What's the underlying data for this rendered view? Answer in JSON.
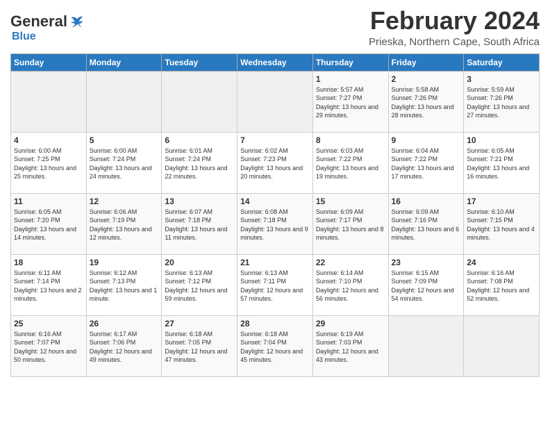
{
  "header": {
    "logo_general": "General",
    "logo_blue": "Blue",
    "title": "February 2024",
    "location": "Prieska, Northern Cape, South Africa"
  },
  "weekdays": [
    "Sunday",
    "Monday",
    "Tuesday",
    "Wednesday",
    "Thursday",
    "Friday",
    "Saturday"
  ],
  "weeks": [
    [
      {
        "day": "",
        "empty": true
      },
      {
        "day": "",
        "empty": true
      },
      {
        "day": "",
        "empty": true
      },
      {
        "day": "",
        "empty": true
      },
      {
        "day": "1",
        "sunrise": "Sunrise: 5:57 AM",
        "sunset": "Sunset: 7:27 PM",
        "daylight": "Daylight: 13 hours and 29 minutes."
      },
      {
        "day": "2",
        "sunrise": "Sunrise: 5:58 AM",
        "sunset": "Sunset: 7:26 PM",
        "daylight": "Daylight: 13 hours and 28 minutes."
      },
      {
        "day": "3",
        "sunrise": "Sunrise: 5:59 AM",
        "sunset": "Sunset: 7:26 PM",
        "daylight": "Daylight: 13 hours and 27 minutes."
      }
    ],
    [
      {
        "day": "4",
        "sunrise": "Sunrise: 6:00 AM",
        "sunset": "Sunset: 7:25 PM",
        "daylight": "Daylight: 13 hours and 25 minutes."
      },
      {
        "day": "5",
        "sunrise": "Sunrise: 6:00 AM",
        "sunset": "Sunset: 7:24 PM",
        "daylight": "Daylight: 13 hours and 24 minutes."
      },
      {
        "day": "6",
        "sunrise": "Sunrise: 6:01 AM",
        "sunset": "Sunset: 7:24 PM",
        "daylight": "Daylight: 13 hours and 22 minutes."
      },
      {
        "day": "7",
        "sunrise": "Sunrise: 6:02 AM",
        "sunset": "Sunset: 7:23 PM",
        "daylight": "Daylight: 13 hours and 20 minutes."
      },
      {
        "day": "8",
        "sunrise": "Sunrise: 6:03 AM",
        "sunset": "Sunset: 7:22 PM",
        "daylight": "Daylight: 13 hours and 19 minutes."
      },
      {
        "day": "9",
        "sunrise": "Sunrise: 6:04 AM",
        "sunset": "Sunset: 7:22 PM",
        "daylight": "Daylight: 13 hours and 17 minutes."
      },
      {
        "day": "10",
        "sunrise": "Sunrise: 6:05 AM",
        "sunset": "Sunset: 7:21 PM",
        "daylight": "Daylight: 13 hours and 16 minutes."
      }
    ],
    [
      {
        "day": "11",
        "sunrise": "Sunrise: 6:05 AM",
        "sunset": "Sunset: 7:20 PM",
        "daylight": "Daylight: 13 hours and 14 minutes."
      },
      {
        "day": "12",
        "sunrise": "Sunrise: 6:06 AM",
        "sunset": "Sunset: 7:19 PM",
        "daylight": "Daylight: 13 hours and 12 minutes."
      },
      {
        "day": "13",
        "sunrise": "Sunrise: 6:07 AM",
        "sunset": "Sunset: 7:18 PM",
        "daylight": "Daylight: 13 hours and 11 minutes."
      },
      {
        "day": "14",
        "sunrise": "Sunrise: 6:08 AM",
        "sunset": "Sunset: 7:18 PM",
        "daylight": "Daylight: 13 hours and 9 minutes."
      },
      {
        "day": "15",
        "sunrise": "Sunrise: 6:09 AM",
        "sunset": "Sunset: 7:17 PM",
        "daylight": "Daylight: 13 hours and 8 minutes."
      },
      {
        "day": "16",
        "sunrise": "Sunrise: 6:09 AM",
        "sunset": "Sunset: 7:16 PM",
        "daylight": "Daylight: 13 hours and 6 minutes."
      },
      {
        "day": "17",
        "sunrise": "Sunrise: 6:10 AM",
        "sunset": "Sunset: 7:15 PM",
        "daylight": "Daylight: 13 hours and 4 minutes."
      }
    ],
    [
      {
        "day": "18",
        "sunrise": "Sunrise: 6:11 AM",
        "sunset": "Sunset: 7:14 PM",
        "daylight": "Daylight: 13 hours and 2 minutes."
      },
      {
        "day": "19",
        "sunrise": "Sunrise: 6:12 AM",
        "sunset": "Sunset: 7:13 PM",
        "daylight": "Daylight: 13 hours and 1 minute."
      },
      {
        "day": "20",
        "sunrise": "Sunrise: 6:13 AM",
        "sunset": "Sunset: 7:12 PM",
        "daylight": "Daylight: 12 hours and 59 minutes."
      },
      {
        "day": "21",
        "sunrise": "Sunrise: 6:13 AM",
        "sunset": "Sunset: 7:11 PM",
        "daylight": "Daylight: 12 hours and 57 minutes."
      },
      {
        "day": "22",
        "sunrise": "Sunrise: 6:14 AM",
        "sunset": "Sunset: 7:10 PM",
        "daylight": "Daylight: 12 hours and 56 minutes."
      },
      {
        "day": "23",
        "sunrise": "Sunrise: 6:15 AM",
        "sunset": "Sunset: 7:09 PM",
        "daylight": "Daylight: 12 hours and 54 minutes."
      },
      {
        "day": "24",
        "sunrise": "Sunrise: 6:16 AM",
        "sunset": "Sunset: 7:08 PM",
        "daylight": "Daylight: 12 hours and 52 minutes."
      }
    ],
    [
      {
        "day": "25",
        "sunrise": "Sunrise: 6:16 AM",
        "sunset": "Sunset: 7:07 PM",
        "daylight": "Daylight: 12 hours and 50 minutes."
      },
      {
        "day": "26",
        "sunrise": "Sunrise: 6:17 AM",
        "sunset": "Sunset: 7:06 PM",
        "daylight": "Daylight: 12 hours and 49 minutes."
      },
      {
        "day": "27",
        "sunrise": "Sunrise: 6:18 AM",
        "sunset": "Sunset: 7:05 PM",
        "daylight": "Daylight: 12 hours and 47 minutes."
      },
      {
        "day": "28",
        "sunrise": "Sunrise: 6:18 AM",
        "sunset": "Sunset: 7:04 PM",
        "daylight": "Daylight: 12 hours and 45 minutes."
      },
      {
        "day": "29",
        "sunrise": "Sunrise: 6:19 AM",
        "sunset": "Sunset: 7:03 PM",
        "daylight": "Daylight: 12 hours and 43 minutes."
      },
      {
        "day": "",
        "empty": true
      },
      {
        "day": "",
        "empty": true
      }
    ]
  ]
}
